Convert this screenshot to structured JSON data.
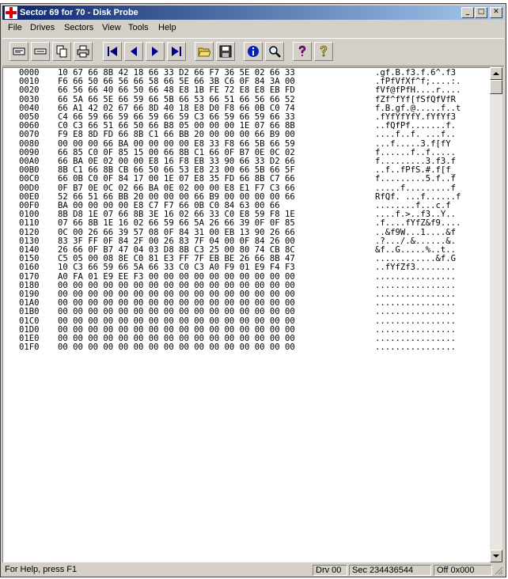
{
  "window": {
    "title": "Sector 69 for 70 - Disk Probe",
    "controls": {
      "minimize": "_",
      "maximize": "□",
      "close": "✕"
    }
  },
  "menu": [
    "File",
    "Drives",
    "Sectors",
    "View",
    "Tools",
    "Help"
  ],
  "toolbar": {
    "icons": [
      "read-sector-icon",
      "write-sector-icon",
      "copy-icon",
      "print-icon",
      "first-sector-icon",
      "previous-sector-icon",
      "next-sector-icon",
      "last-sector-icon",
      "open-folder-icon",
      "save-icon",
      "info-icon",
      "search-icon",
      "help-icon",
      "context-help-icon"
    ]
  },
  "hex_rows": [
    {
      "offset": "0000",
      "hex": "10 67 66 8B 42 18 66 33 D2 66 F7 36 5E 02 66 33",
      "ascii": ".gf.B.f3.f.6^.f3"
    },
    {
      "offset": "0010",
      "hex": "F6 66 50 66 56 66 58 66 5E 66 3B C6 0F 84 3A 00",
      "ascii": ".fPfVfXf^f;....:."
    },
    {
      "offset": "0020",
      "hex": "66 56 66 40 66 50 66 48 E8 1B FE 72 E8 E8 EB FD",
      "ascii": "fVf@fPfH....r...."
    },
    {
      "offset": "0030",
      "hex": "66 5A 66 5E 66 59 66 5B 66 53 66 51 66 56 66 52",
      "ascii": "fZf^fYf[fSfQfVfR"
    },
    {
      "offset": "0040",
      "hex": "66 A1 42 02 67 66 8D 40 18 E8 D0 F8 66 0B C0 74",
      "ascii": "f.B.gf.@.....f..t"
    },
    {
      "offset": "0050",
      "hex": "C4 66 59 66 59 66 59 66 59 C3 66 59 66 59 66 33",
      "ascii": ".fYfYfYfY.fYfYf3"
    },
    {
      "offset": "0060",
      "hex": "C0 C3 66 51 66 50 66 B8 05 00 00 00 1E 07 66 8B",
      "ascii": "..fQfPf.......f."
    },
    {
      "offset": "0070",
      "hex": "F9 E8 8D FD 66 8B C1 66 BB 20 00 00 00 66 B9 00",
      "ascii": "....f..f. ...f.."
    },
    {
      "offset": "0080",
      "hex": "00 00 00 66 BA 00 00 00 00 E8 33 F8 66 5B 66 59",
      "ascii": "...f.....3.f[fY"
    },
    {
      "offset": "0090",
      "hex": "66 85 C0 0F 85 15 00 66 8B C1 66 0F B7 0E 0C 02",
      "ascii": "f......f..f....."
    },
    {
      "offset": "00A0",
      "hex": "66 BA 0E 02 00 00 E8 16 F8 EB 33 90 66 33 D2 66",
      "ascii": "f.........3.f3.f"
    },
    {
      "offset": "00B0",
      "hex": "8B C1 66 8B CB 66 50 66 53 E8 23 00 66 5B 66 5F",
      "ascii": "..f..fPfS.#.f[f_"
    },
    {
      "offset": "00C0",
      "hex": "66 0B C0 0F 84 17 00 1E 07 E8 35 FD 66 8B C7 66",
      "ascii": "f.........5.f..f"
    },
    {
      "offset": "00D0",
      "hex": "0F B7 0E 0C 02 66 BA 0E 02 00 00 E8 E1 F7 C3 66",
      "ascii": ".....f.........f"
    },
    {
      "offset": "00E0",
      "hex": "52 66 51 66 BB 20 00 00 00 66 B9 00 00 00 00 66",
      "ascii": "RfQf. ...f......f"
    },
    {
      "offset": "00F0",
      "hex": "BA 00 00 00 00 E8 C7 F7 66 0B C0 84 63 00 66",
      "ascii": "........f...c.f"
    },
    {
      "offset": "0100",
      "hex": "8B D8 1E 07 66 8B 3E 16 02 66 33 C0 E8 59 F8 1E",
      "ascii": "....f.>..f3..Y.."
    },
    {
      "offset": "0110",
      "hex": "07 66 8B 1E 16 02 66 59 66 5A 26 66 39 0F 0F 85",
      "ascii": ".f....fYfZ&f9...."
    },
    {
      "offset": "0120",
      "hex": "0C 00 26 66 39 57 08 0F 84 31 00 EB 13 90 26 66",
      "ascii": "..&f9W...1....&f"
    },
    {
      "offset": "0130",
      "hex": "83 3F FF 0F 84 2F 00 26 83 7F 04 00 0F 84 26 00",
      "ascii": ".?.../.&......&."
    },
    {
      "offset": "0140",
      "hex": "26 66 0F B7 47 04 03 D8 8B C3 25 00 80 74 CB 8C",
      "ascii": "&f..G.....%..t.."
    },
    {
      "offset": "0150",
      "hex": "C5 05 00 08 8E C0 81 E3 FF 7F EB BE 26 66 8B 47",
      "ascii": "............&f.G"
    },
    {
      "offset": "0160",
      "hex": "10 C3 66 59 66 5A 66 33 C0 C3 A0 F9 01 E9 F4 F3",
      "ascii": "..fYfZf3........"
    },
    {
      "offset": "0170",
      "hex": "A0 FA 01 E9 EE F3 00 00 00 00 00 00 00 00 00 00",
      "ascii": "................"
    },
    {
      "offset": "0180",
      "hex": "00 00 00 00 00 00 00 00 00 00 00 00 00 00 00 00",
      "ascii": "................"
    },
    {
      "offset": "0190",
      "hex": "00 00 00 00 00 00 00 00 00 00 00 00 00 00 00 00",
      "ascii": "................"
    },
    {
      "offset": "01A0",
      "hex": "00 00 00 00 00 00 00 00 00 00 00 00 00 00 00 00",
      "ascii": "................"
    },
    {
      "offset": "01B0",
      "hex": "00 00 00 00 00 00 00 00 00 00 00 00 00 00 00 00",
      "ascii": "................"
    },
    {
      "offset": "01C0",
      "hex": "00 00 00 00 00 00 00 00 00 00 00 00 00 00 00 00",
      "ascii": "................"
    },
    {
      "offset": "01D0",
      "hex": "00 00 00 00 00 00 00 00 00 00 00 00 00 00 00 00",
      "ascii": "................"
    },
    {
      "offset": "01E0",
      "hex": "00 00 00 00 00 00 00 00 00 00 00 00 00 00 00 00",
      "ascii": "................"
    },
    {
      "offset": "01F0",
      "hex": "00 00 00 00 00 00 00 00 00 00 00 00 00 00 00 00",
      "ascii": "................"
    }
  ],
  "status": {
    "help": "For Help, press F1",
    "drive": "Drv  00",
    "sector": "Sec 234436544",
    "offset": "Off 0x000"
  }
}
